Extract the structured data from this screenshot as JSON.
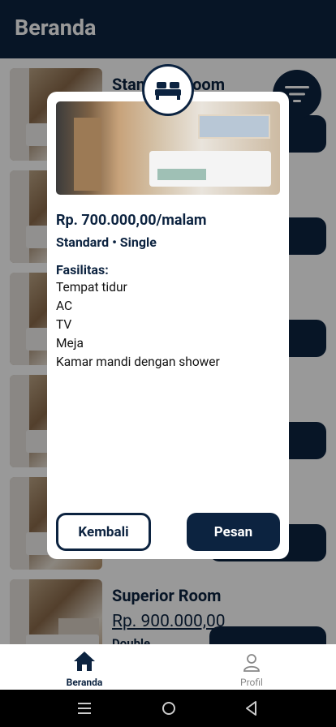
{
  "appbar": {
    "title": "Beranda"
  },
  "rooms": [
    {
      "name": "Standard Room",
      "price": "",
      "class": ""
    },
    {
      "name": "",
      "price": "",
      "class": ""
    },
    {
      "name": "",
      "price": "",
      "class": ""
    },
    {
      "name": "",
      "price": "",
      "class": ""
    },
    {
      "name": "",
      "price": "",
      "class": ""
    },
    {
      "name": "Superior Room",
      "price": "Rp. 900.000,00",
      "class": "Double"
    }
  ],
  "dialog": {
    "price": "Rp. 700.000,00/malam",
    "type": "Standard • Single",
    "facilities_title": "Fasilitas:",
    "facilities": [
      "Tempat tidur",
      "AC",
      "TV",
      "Meja",
      "Kamar mandi dengan shower"
    ],
    "back_label": "Kembali",
    "order_label": "Pesan"
  },
  "bottom_nav": {
    "home": "Beranda",
    "profile": "Profil"
  },
  "colors": {
    "primary": "#0c2340",
    "scrim": "rgba(0,0,0,0.40)"
  },
  "icons": {
    "fab": "filter-icon",
    "badge": "bed-icon",
    "home": "home-icon",
    "profile": "person-icon"
  }
}
